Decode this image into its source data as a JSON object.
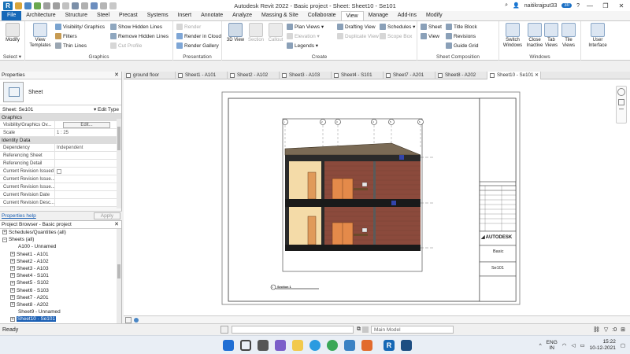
{
  "titlebar": {
    "app_logo": "R",
    "title": "Autodesk Revit 2022 - Basic project - Sheet: Sheet10 - Se101",
    "user": "naitikrajput33",
    "badge": "30",
    "controls": [
      "—",
      "❐",
      "✕"
    ]
  },
  "ribbon_tabs": [
    "File",
    "Architecture",
    "Structure",
    "Steel",
    "Precast",
    "Systems",
    "Insert",
    "Annotate",
    "Analyze",
    "Massing & Site",
    "Collaborate",
    "View",
    "Manage",
    "Add-Ins",
    "Modify"
  ],
  "ribbon": {
    "select": {
      "modify": "Modify",
      "label": "Select ▾"
    },
    "graphics": {
      "label": "Graphics",
      "view_templates": "View Templates",
      "visibility": "Visibility/ Graphics",
      "filters": "Filters",
      "thin_lines": "Thin  Lines",
      "show_hidden": "Show  Hidden Lines",
      "remove_hidden": "Remove  Hidden Lines",
      "cut_profile": "Cut  Profile"
    },
    "presentation": {
      "label": "Presentation",
      "render": "Render",
      "render_cloud": "Render  in Cloud",
      "render_gallery": "Render  Gallery"
    },
    "create": {
      "label": "Create",
      "view_3d": "3D View",
      "section": "Section",
      "callout": "Callout",
      "plan_views": "Plan Views ▾",
      "elevation": "Elevation ▾",
      "legends": "Legends ▾",
      "drafting_view": "Drafting  View",
      "duplicate_view": "Duplicate  View ▾",
      "schedules": "Schedules ▾",
      "scope_box": "Scope  Box"
    },
    "sheet_composition": {
      "label": "Sheet Composition",
      "sheet": "Sheet",
      "view": "View",
      "title_block": "Title  Block",
      "revisions": "Revisions",
      "guide_grid": "Guide  Grid"
    },
    "windows": {
      "label": "Windows",
      "switch": "Switch Windows",
      "close_inactive": "Close Inactive",
      "tab_views": "Tab Views",
      "tile_views": "Tile Views"
    },
    "user_interface": "User Interface"
  },
  "view_tabs": [
    "ground floor",
    "Sheet1 - A101",
    "Sheet2 - A102",
    "Sheet3 - A103",
    "Sheet4 - S101",
    "Sheet7 - A201",
    "Sheet8 - A202",
    "Sheet10 - Se101"
  ],
  "properties": {
    "title": "Properties",
    "type_name": "Sheet",
    "selector": "Sheet: Se101",
    "edit_type": "Edit Type",
    "cat_graphics": "Graphics",
    "rows_graphics": [
      {
        "k": "Visibility/Graphics Ov...",
        "v": ""
      },
      {
        "k": "Scale",
        "v": "1 : 25"
      }
    ],
    "edit_button": "Edit...",
    "cat_identity": "Identity Data",
    "rows_identity": [
      {
        "k": "Dependency",
        "v": "Independent"
      },
      {
        "k": "Referencing Sheet",
        "v": ""
      },
      {
        "k": "Referencing Detail",
        "v": ""
      },
      {
        "k": "Current Revision Issued",
        "v": ""
      },
      {
        "k": "Current Revision Issue...",
        "v": ""
      },
      {
        "k": "Current Revision Issue...",
        "v": ""
      },
      {
        "k": "Current Revision Date",
        "v": ""
      },
      {
        "k": "Current Revision Desc...",
        "v": ""
      }
    ],
    "help": "Properties help",
    "apply": "Apply"
  },
  "project_browser": {
    "title": "Project Browser - Basic project",
    "items": [
      {
        "label": "Schedules/Quantities (all)",
        "indent": 0,
        "toggle": "+"
      },
      {
        "label": "Sheets (all)",
        "indent": 0,
        "toggle": "−"
      },
      {
        "label": "A100 - Unnamed",
        "indent": 2,
        "toggle": ""
      },
      {
        "label": "Sheet1 - A101",
        "indent": 1,
        "toggle": "+"
      },
      {
        "label": "Sheet2 - A102",
        "indent": 1,
        "toggle": "+"
      },
      {
        "label": "Sheet3 - A103",
        "indent": 1,
        "toggle": "+"
      },
      {
        "label": "Sheet4 - S101",
        "indent": 1,
        "toggle": "+"
      },
      {
        "label": "Sheet5 - S102",
        "indent": 1,
        "toggle": "+"
      },
      {
        "label": "Sheet6 - S103",
        "indent": 1,
        "toggle": "+"
      },
      {
        "label": "Sheet7 - A201",
        "indent": 1,
        "toggle": "+"
      },
      {
        "label": "Sheet8 - A202",
        "indent": 1,
        "toggle": "+"
      },
      {
        "label": "Sheet9 - Unnamed",
        "indent": 2,
        "toggle": ""
      },
      {
        "label": "Sheet10 - Se101",
        "indent": 1,
        "toggle": "+",
        "selected": true
      }
    ]
  },
  "sheet": {
    "title_block_company": "AUTODESK",
    "project_name": "Basic",
    "sheet_number": "Se101",
    "view_label": "Section 1",
    "view_number": "1",
    "grid_bubbles": [
      "1",
      "2",
      "3",
      "4",
      "5",
      "6"
    ]
  },
  "statusbar": {
    "ready": "Ready",
    "model": "Main Model",
    "filter_count": ":0"
  },
  "taskbar": {
    "lang": "ENG",
    "region": "IN",
    "time": "15:22",
    "date": "10-12-2021"
  },
  "colors": {
    "accent": "#1568b8",
    "brick": "#8b4a3c",
    "roof": "#7a6a55",
    "slab": "#1a1a1a",
    "wall_cream": "#f4dba8",
    "door": "#e09a5a"
  }
}
